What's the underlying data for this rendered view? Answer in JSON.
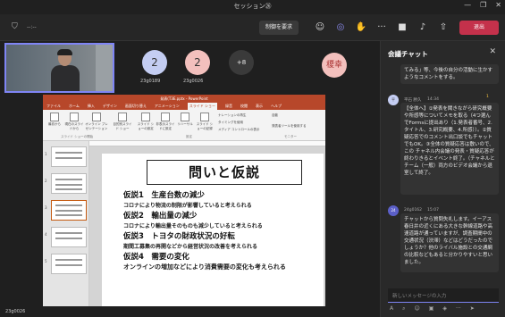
{
  "window": {
    "title": "セッション㉖",
    "controls": [
      "—",
      "❐",
      "✕"
    ]
  },
  "toolbar": {
    "timer": "--:--",
    "request_control": "制御を要求",
    "leave": "退出",
    "icons": [
      "people-icon",
      "chat-icon",
      "reactions-icon",
      "more-icon",
      "camera-icon",
      "mic-icon",
      "share-icon"
    ],
    "accent": "#7f85f5",
    "leave_color": "#c4314b"
  },
  "participants": {
    "tiles": [
      {
        "number": "2",
        "name": "23g0189",
        "color": "#c4cdf2"
      },
      {
        "number": "2",
        "name": "23g0026",
        "color": "#f3c0bd"
      }
    ],
    "more": "+8",
    "named_tile": "榎幸",
    "self_label": "23g0026"
  },
  "ppt": {
    "title": "発表(T3E.pptx - PowerPoint",
    "tabs": [
      "ファイル",
      "ホーム",
      "挿入",
      "デザイン",
      "画面切り替え",
      "アニメーション",
      "スライド ショー",
      "録音",
      "校閲",
      "表示",
      "ヘルプ"
    ],
    "active_tab": "スライド ショー",
    "ribbon": {
      "b1": "最初から",
      "b2": "現在のスライドから",
      "b3": "オンライン プレゼンテーション",
      "b4": "目的別スライド ショー",
      "b5": "スライド ショーの設定",
      "b6": "非表示スライドに設定",
      "b7": "リハーサル",
      "b8": "スライド ショーの記録",
      "c1": "ナレーションの再生",
      "c2": "タイミングを使用",
      "c3": "メディア コントロールの表示",
      "monitor": "自動",
      "presenter": "発表者ツールを使用する",
      "g1": "スライド ショーの開始",
      "g2": "設定",
      "g3": "モニター"
    },
    "thumb_numbers": [
      "1",
      "2",
      "3",
      "4",
      "5"
    ]
  },
  "slide": {
    "title": "問いと仮説",
    "h1": "仮説1　生産台数の減少",
    "s1": "コロナにより物流の制限が影響していると考えられる",
    "h2": "仮説2　輸出量の減少",
    "s2": "コロナにより輸出量そのものも減少していると考えられる",
    "h3": "仮説3　トヨタの財政状況の好転",
    "s3": "期間工募集の再開などから経営状況の改善を考えられる",
    "h4": "仮説4　需要の変化",
    "s4": "オンラインの増加などにより消費需要の変化も考えられる"
  },
  "chat": {
    "header": "会議チャット",
    "msg0": "てみる」等、今後の自分の活動に生かすようなコメントをする。",
    "m1_author": "平石 勝久",
    "m1_time": "14:34",
    "m1_react": "1",
    "m1_text": "【全体へ】①発表を聞きながら研究概要や所感等についてメモを取る（4つ選んでFormsに提出あり（1.発表者番号、2.タイトル、3.研究概要、4.所感））。②質疑応答でのコメント出口談でもチャットでもOK。③全体の質疑応答は敷いので、この チャネル内会議の発表・質疑応答が終わりきるとイベント終了。（チャネルとチーム（一般）両方のビデオ会議から退室して終了。",
    "m2_author": "24g0162",
    "m2_time": "15:07",
    "m2_text": "チャットから質問失礼します。イーアス春日井の近くにある大きな幹線道路や高速道路が通っていますが、調査期間中の交通状況（渋滞）などはどうだったのでしょうか？他のライバル施設との交通網の比較などもあると分かりやすいと思いました。",
    "input_placeholder": "新しいメッセージの入力"
  }
}
